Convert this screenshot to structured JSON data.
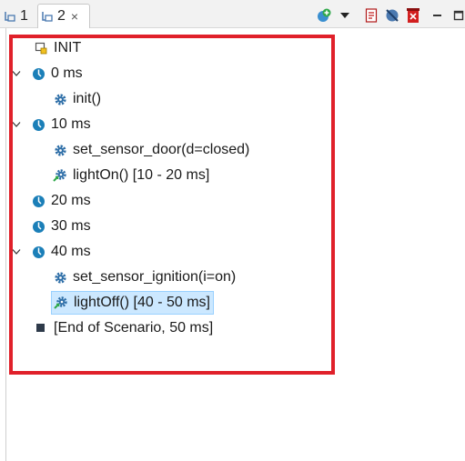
{
  "tabs": [
    {
      "label": "1"
    },
    {
      "label": "2",
      "close": "×"
    }
  ],
  "toolbar": {
    "icons": [
      "add-plus-icon",
      "view-menu-arrow-icon",
      "export-report-icon",
      "disable-filter-icon",
      "remove-all-icon",
      "minimize-icon",
      "maximize-icon"
    ]
  },
  "tree": {
    "init": "INIT",
    "t0": "0 ms",
    "init_call": "init()",
    "t10": "10 ms",
    "set_door": "set_sensor_door(d=closed)",
    "light_on": "lightOn() [10 - 20 ms]",
    "t20": "20 ms",
    "t30": "30 ms",
    "t40": "40 ms",
    "set_ignition": "set_sensor_ignition(i=on)",
    "light_off": "lightOff() [40 - 50 ms]",
    "end": "[End of Scenario, 50 ms]"
  },
  "colors": {
    "highlight_border": "#e0202a",
    "time_icon": "#1b7fb8",
    "gear_icon": "#2f6fa8",
    "selection": "#cce8ff"
  }
}
